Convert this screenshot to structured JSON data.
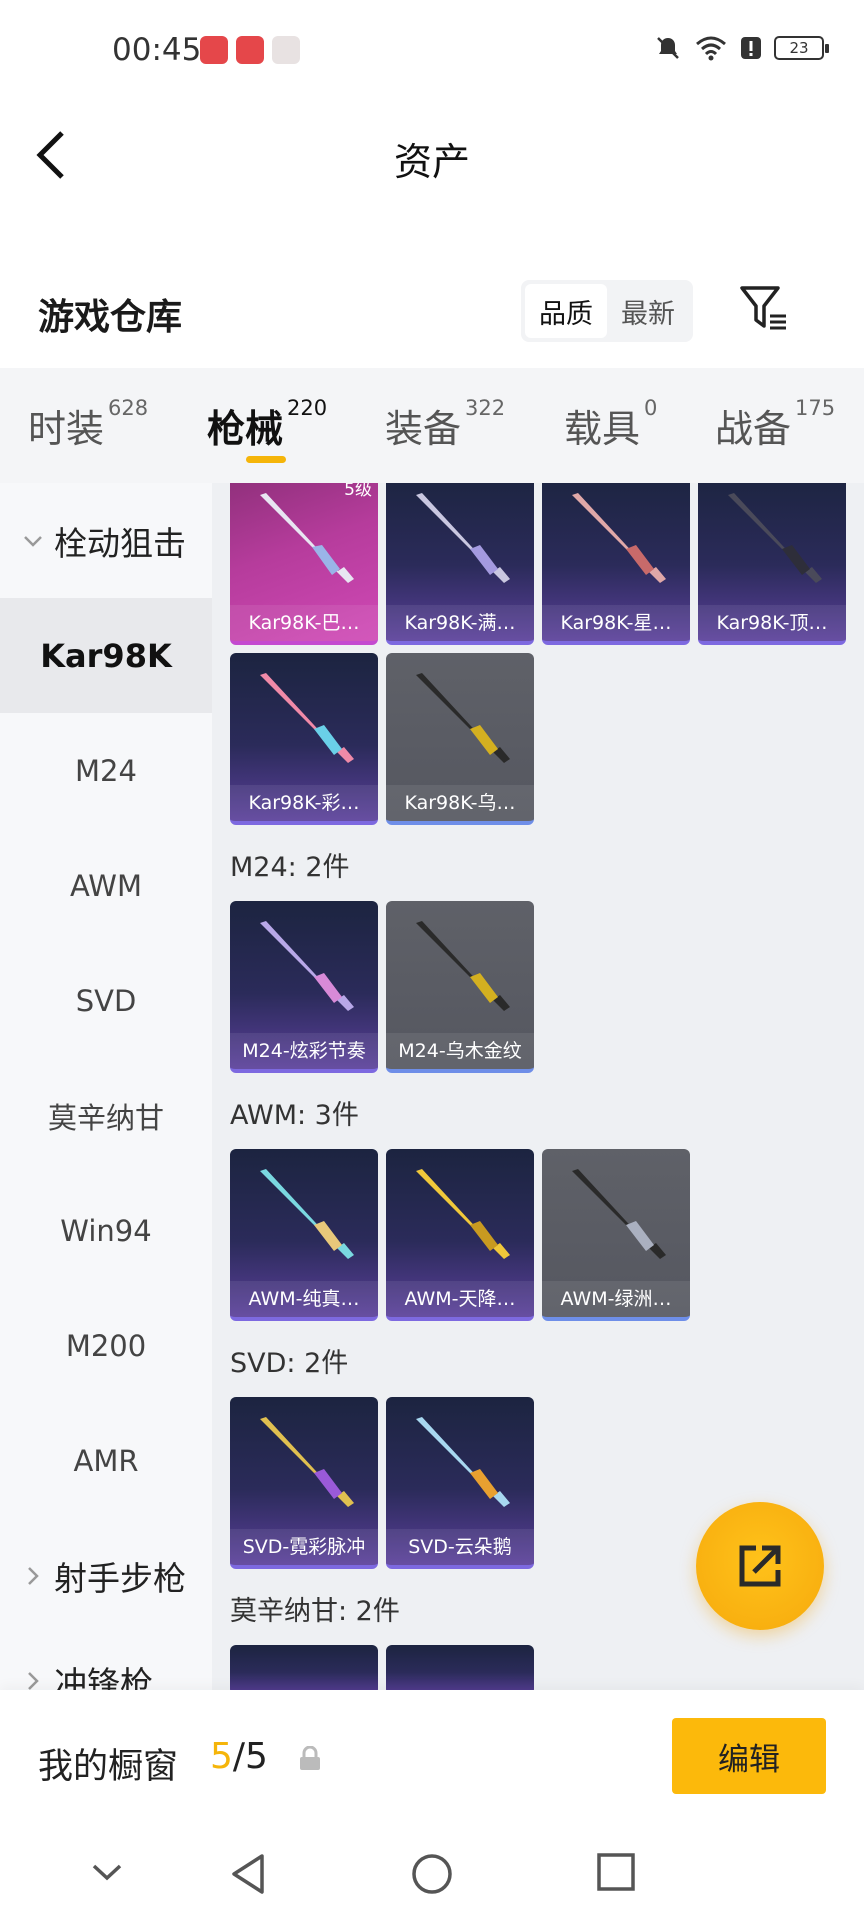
{
  "status_bar": {
    "time": "00:45",
    "battery": "23",
    "notification_icons": [
      "app-notification-icon",
      "app-notification-icon",
      "app-notification-icon"
    ],
    "system_icons": [
      "bell-muted-icon",
      "wifi-icon",
      "alert-icon",
      "battery-icon"
    ]
  },
  "header": {
    "title": "资产",
    "back_icon": "chevron-left-icon"
  },
  "warehouse": {
    "title": "游戏仓库",
    "sort_options": [
      "品质",
      "最新"
    ],
    "sort_selected": "品质",
    "filter_icon": "filter-icon"
  },
  "tabs": [
    {
      "label": "时装",
      "count": "628",
      "active": false
    },
    {
      "label": "枪械",
      "count": "220",
      "active": true
    },
    {
      "label": "装备",
      "count": "322",
      "active": false
    },
    {
      "label": "载具",
      "count": "0",
      "active": false
    },
    {
      "label": "战备",
      "count": "175",
      "active": false
    }
  ],
  "colors": {
    "accent": "#fcb90b",
    "card_purple": "#2b2b5a",
    "card_pink": "#b63c9c",
    "card_grey": "#5f6168"
  },
  "sidebar": {
    "group_bolt": "栓动狙击",
    "group_marksman": "射手步枪",
    "group_next_partial": "冲锋枪",
    "items": [
      "Kar98K",
      "M24",
      "AWM",
      "SVD",
      "莫辛纳甘",
      "Win94",
      "M200",
      "AMR"
    ],
    "active_item": "Kar98K"
  },
  "content": {
    "kar98k_items": [
      {
        "name": "Kar98K-巴…",
        "badge": "5级",
        "style": "pink"
      },
      {
        "name": "Kar98K-满…",
        "style": "purple"
      },
      {
        "name": "Kar98K-星…",
        "style": "purple"
      },
      {
        "name": "Kar98K-顶…",
        "style": "purple"
      },
      {
        "name": "Kar98K-彩…",
        "style": "purple"
      },
      {
        "name": "Kar98K-乌…",
        "style": "grey"
      }
    ],
    "sections": [
      {
        "title": "M24: 2件",
        "items": [
          {
            "name": "M24-炫彩节奏",
            "style": "purple"
          },
          {
            "name": "M24-乌木金纹",
            "style": "grey"
          }
        ]
      },
      {
        "title": "AWM: 3件",
        "items": [
          {
            "name": "AWM-纯真…",
            "style": "purple"
          },
          {
            "name": "AWM-天降…",
            "style": "purple"
          },
          {
            "name": "AWM-绿洲…",
            "style": "grey"
          }
        ]
      },
      {
        "title": "SVD: 2件",
        "items": [
          {
            "name": "SVD-霓彩脉冲",
            "style": "purple"
          },
          {
            "name": "SVD-云朵鹅",
            "style": "purple"
          }
        ]
      },
      {
        "title": "莫辛纳甘: 2件",
        "items": []
      }
    ]
  },
  "fab": {
    "icon": "share-export-icon"
  },
  "showcase": {
    "label": "我的橱窗",
    "current": "5",
    "separator": "/",
    "max": "5",
    "lock_icon": "lock-icon",
    "edit_label": "编辑"
  },
  "nav": {
    "icons": [
      "chevron-down-icon",
      "nav-back-icon",
      "nav-home-icon",
      "nav-recents-icon"
    ]
  }
}
